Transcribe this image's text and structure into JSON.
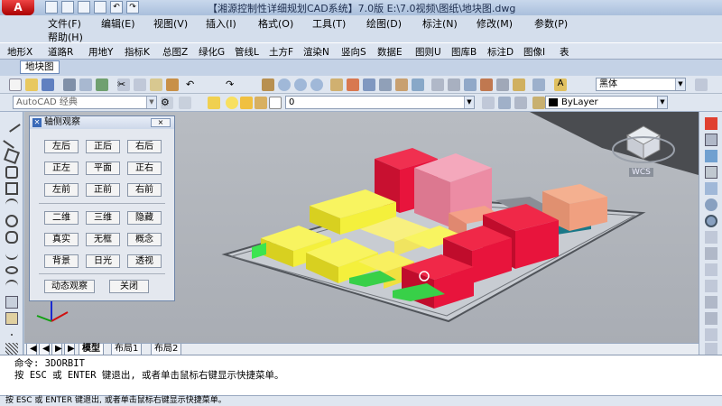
{
  "titlebar": {
    "title": "【湘源控制性详细规划CAD系统】7.0版    E:\\7.0视频\\图纸\\地块图.dwg"
  },
  "menubar": {
    "row1": [
      "文件(F)",
      "编辑(E)",
      "视图(V)",
      "插入(I)",
      "格式(O)",
      "工具(T)",
      "绘图(D)",
      "标注(N)",
      "修改(M)",
      "参数(P)"
    ],
    "row2": [
      "帮助(H)"
    ]
  },
  "custom_toolbar": {
    "items": [
      "地形X",
      "道路R",
      "用地Y",
      "指标K",
      "总图Z",
      "绿化G",
      "管线L",
      "土方F",
      "渲染N",
      "竖向S",
      "数据E",
      "图则U",
      "图库B",
      "标注D",
      "图像I",
      "表"
    ]
  },
  "tabs": {
    "drawing_tab": "地块图"
  },
  "toolbar2": {
    "workspace": "AutoCAD 经典",
    "layer_value": "0",
    "font_value": "黑体",
    "linetype": "ByLayer"
  },
  "panel": {
    "title": "轴侧观察",
    "close": "×",
    "group1": [
      "左后",
      "正后",
      "右后",
      "正左",
      "平面",
      "正右",
      "左前",
      "正前",
      "右前"
    ],
    "group2": [
      "二维",
      "三维",
      "隐藏",
      "真实",
      "无框",
      "概念",
      "背景",
      "日光",
      "透视"
    ],
    "dynamic_btn": "动态观察",
    "close_btn": "关闭"
  },
  "viewcube": {
    "label": "WCS"
  },
  "layout_tabs": [
    "模型",
    "布局1",
    "布局2"
  ],
  "command": {
    "line1": "命令: 3DORBIT",
    "line2": "按 ESC 或 ENTER 键退出, 或者单击鼠标右键显示快捷菜单。"
  },
  "status": {
    "text": "按 ESC 或 ENTER 键退出, 或者单击鼠标右键显示快捷菜单。"
  },
  "colors": {
    "red": "#e8143c",
    "pink": "#ec8ca4",
    "yellow": "#f4f03c",
    "green": "#3ce450",
    "salmon": "#f0a080",
    "teal": "#1a7888"
  }
}
